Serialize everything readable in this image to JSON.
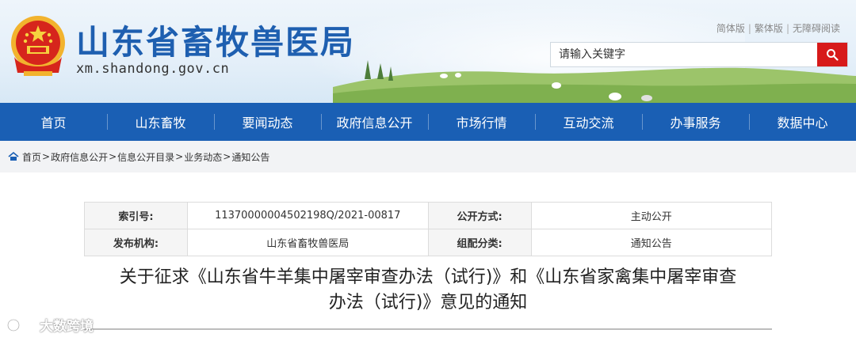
{
  "header": {
    "site_title": "山东省畜牧兽医局",
    "site_domain": "xm.shandong.gov.cn",
    "top_links": [
      "简体版",
      "繁体版",
      "无障碍阅读"
    ],
    "search": {
      "placeholder": "请输入关键字"
    }
  },
  "nav": {
    "items": [
      "首页",
      "山东畜牧",
      "要闻动态",
      "政府信息公开",
      "市场行情",
      "互动交流",
      "办事服务",
      "数据中心"
    ]
  },
  "breadcrumb": {
    "items": [
      "首页",
      "政府信息公开",
      "信息公开目录",
      "业务动态",
      "通知公告"
    ],
    "separator": ">"
  },
  "info": {
    "index_label": "索引号:",
    "index_value": "11370000004502198Q/2021-00817",
    "publish_mode_label": "公开方式:",
    "publish_mode_value": "主动公开",
    "publisher_label": "发布机构:",
    "publisher_value": "山东省畜牧兽医局",
    "category_label": "组配分类:",
    "category_value": "通知公告"
  },
  "article": {
    "title_line1": "关于征求《山东省牛羊集中屠宰审查办法（试行)》和《山东省家禽集中屠宰审查",
    "title_line2": "办法（试行)》意见的通知"
  },
  "watermark": {
    "text": "大数跨境"
  },
  "colors": {
    "brand_blue": "#1a5fb4",
    "search_red": "#d71a1a",
    "title_blue": "#1e5fb0"
  }
}
